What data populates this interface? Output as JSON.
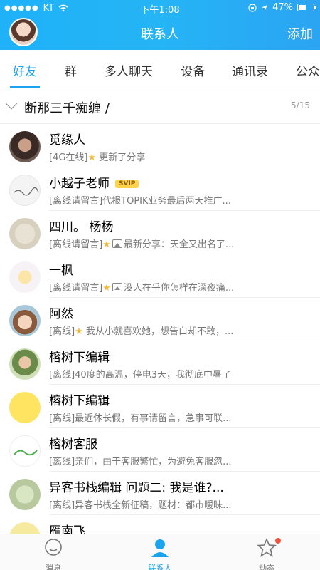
{
  "status_bar": {
    "carrier": "KT",
    "time": "下午1:08",
    "battery": "47%",
    "battery_level": 0.47
  },
  "header": {
    "title": "联系人",
    "add_label": "添加"
  },
  "tabs": [
    "好友",
    "群",
    "多人聊天",
    "设备",
    "通讯录",
    "公众"
  ],
  "group": {
    "name": "断那三千痴缠 /",
    "count": "5/15"
  },
  "contacts": [
    {
      "name": "觅缘人",
      "status": "[4G在线]",
      "detail": "更新了分享",
      "star": true,
      "image": false
    },
    {
      "name": "小越子老师",
      "badge": "SVIP",
      "status": "[离线请留言]",
      "detail": "代报TOPIK业务最后两天推广...",
      "star": false,
      "image": false
    },
    {
      "name": "四川。  杨杨",
      "status": "[离线请留言]",
      "detail": "最新分享：天全又出名了...",
      "star": true,
      "image": true
    },
    {
      "name": "一枫",
      "status": "[离线请留言]",
      "detail": "没人在乎你怎样在深夜痛...",
      "star": true,
      "image": true
    },
    {
      "name": "阿然",
      "status": "[离线]",
      "detail": "我从小就喜欢她，想告白却不敢，...",
      "star": true,
      "image": false
    },
    {
      "name": "榕树下编辑",
      "status": "[离线]",
      "detail": "40度的高温，停电3天，我彻底中暑了",
      "star": false,
      "image": false
    },
    {
      "name": "榕树下编辑",
      "status": "[离线]",
      "detail": "最近休长假，有事请留言，急事可联...",
      "star": false,
      "image": false
    },
    {
      "name": "榕树客服",
      "status": "[离线]",
      "detail": "亲们，由于客服繁忙，为避免客服忽...",
      "star": false,
      "image": false
    },
    {
      "name": "异客书栈编辑 问题二: 我是谁?...",
      "status": "[离线]",
      "detail": "异客书栈全新征稿，题材：都市暧昧...",
      "star": false,
      "image": false
    },
    {
      "name": "雁南飞",
      "status": "",
      "detail": "",
      "star": false,
      "image": false
    }
  ],
  "bottom_nav": [
    {
      "label": "消息"
    },
    {
      "label": "联系人"
    },
    {
      "label": "动态"
    }
  ],
  "colors": {
    "accent": "#1aa3ef",
    "header_gradient": [
      "#1fb2f8",
      "#2ba4f2"
    ],
    "svip": "#ffd34a",
    "notification": "#f3523f"
  }
}
